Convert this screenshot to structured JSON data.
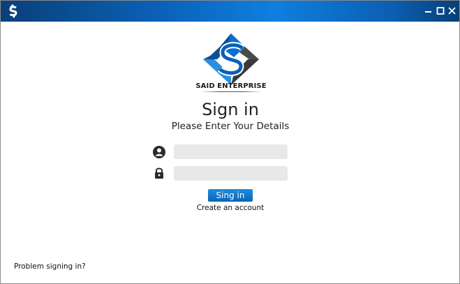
{
  "window": {
    "controls": [
      "minimize-icon",
      "maximize-icon",
      "close-icon"
    ]
  },
  "brand": {
    "name": "SAID ENTERPRISE",
    "colors": {
      "primary": "#0b6fd0",
      "dark": "#3a3a3a",
      "titlebar": "#0b61b8"
    }
  },
  "login": {
    "title": "Sign in",
    "subtitle": "Please Enter Your Details",
    "username": {
      "value": "",
      "placeholder": "",
      "icon": "user-icon"
    },
    "password": {
      "value": "",
      "placeholder": "",
      "icon": "lock-icon"
    },
    "submit_label": "Sing in",
    "create_account_label": "Create an account"
  },
  "footer": {
    "problem_label": "Problem signing in?"
  }
}
